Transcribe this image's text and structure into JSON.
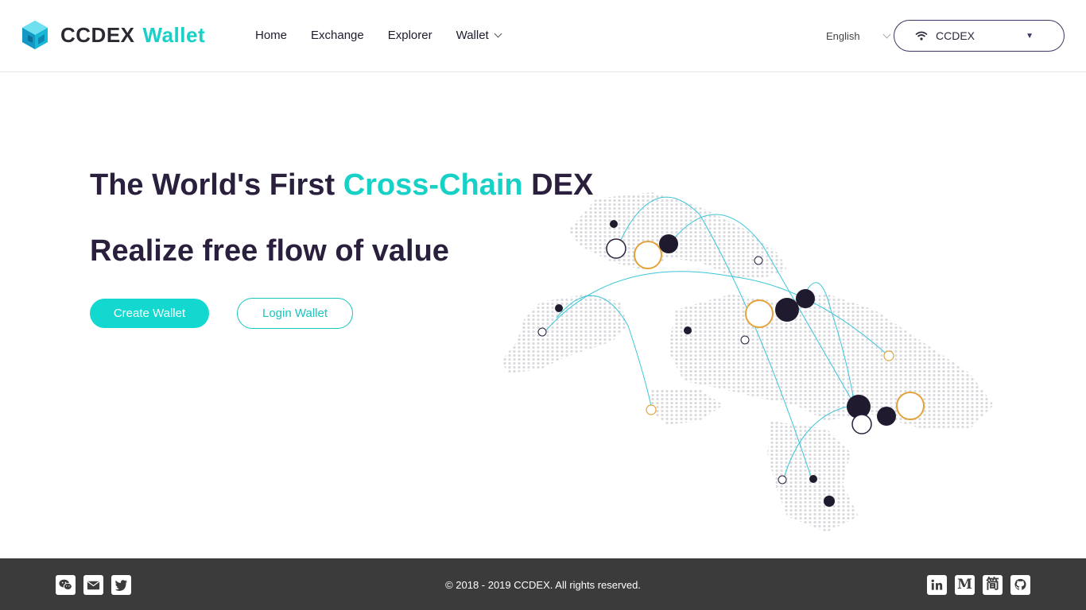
{
  "header": {
    "logo_brand": "CCDEX",
    "logo_accent": "Wallet",
    "nav": {
      "home": "Home",
      "exchange": "Exchange",
      "explorer": "Explorer",
      "wallet": "Wallet"
    },
    "language": "English",
    "network": "CCDEX"
  },
  "hero": {
    "title_part1": "The World's First ",
    "title_highlight": "Cross-Chain",
    "title_part2": " DEX",
    "subtitle": "Realize free flow of value",
    "create_button": "Create Wallet",
    "login_button": "Login Wallet"
  },
  "footer": {
    "copyright": "© 2018 - 2019 CCDEX. All rights reserved.",
    "icons_left": [
      "wechat-icon",
      "mail-icon",
      "twitter-icon"
    ],
    "icons_right": [
      "linkedin-icon",
      "medium-icon",
      "jianshu-icon",
      "github-icon"
    ],
    "medium_glyph": "M",
    "jianshu_glyph": "简"
  },
  "colors": {
    "accent": "#17d1c6",
    "dark": "#2a1f3d",
    "footer_bg": "#3b3b3b"
  }
}
